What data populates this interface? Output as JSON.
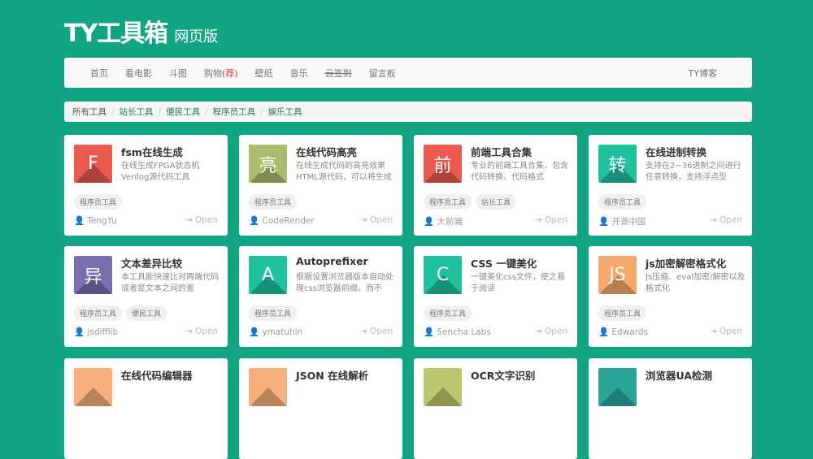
{
  "header": {
    "title": "TY工具箱",
    "subtitle": "网页版"
  },
  "nav": {
    "items": [
      "首页",
      "看电影",
      "斗图"
    ],
    "shop": "购物",
    "shop_hot": "(荐)",
    "items2": [
      "壁纸",
      "音乐",
      "云签到",
      "留言板"
    ],
    "right": "TY博客"
  },
  "breadcrumb": [
    "所有工具",
    "站长工具",
    "便民工具",
    "程序员工具",
    "娱乐工具"
  ],
  "open_label": "Open",
  "cards": [
    {
      "letter": "F",
      "color": "#ea5a4f",
      "title": "fsm在线生成",
      "desc": "在线生成FPGA状态机Verilog源代码工具",
      "tags": [
        "程序员工具"
      ],
      "author": "TengYu"
    },
    {
      "letter": "亮",
      "color": "#a9bd6b",
      "title": "在线代码高亮",
      "desc": "在线生成代码的高亮效果HTML源代码，可以将生成",
      "tags": [
        "程序员工具"
      ],
      "author": "CodeRender"
    },
    {
      "letter": "前",
      "color": "#ea5a4f",
      "title": "前端工具合集",
      "desc": "专业的前端工具合集，包含代码转换、代码格式",
      "tags": [
        "程序员工具",
        "站长工具"
      ],
      "author": "大前端"
    },
    {
      "letter": "转",
      "color": "#1fc19e",
      "title": "在线进制转换",
      "desc": "支持在2~36进制之间进行任意转换，支持浮点型",
      "tags": [
        "程序员工具"
      ],
      "author": "开源中国"
    },
    {
      "letter": "异",
      "color": "#776fb0",
      "title": "文本差异比较",
      "desc": "本工具能快速比对两端代码或者是文本之间的差",
      "tags": [
        "程序员工具",
        "便民工具"
      ],
      "author": "jsdifflib"
    },
    {
      "letter": "A",
      "color": "#1fc19e",
      "title": "Autoprefixer",
      "desc": "根据设置浏览器版本自动处理css浏览器前缀。而不",
      "tags": [
        "程序员工具"
      ],
      "author": "ymatuhin"
    },
    {
      "letter": "C",
      "color": "#1fc19e",
      "title": "CSS 一键美化",
      "desc": "一键美化css文件，使之易于阅读",
      "tags": [
        "程序员工具"
      ],
      "author": "Sencha Labs"
    },
    {
      "letter": "JS",
      "color": "#f5a86a",
      "title": "js加密解密格式化",
      "desc": "Js压缩、eval加密/解密以及格式化",
      "tags": [
        "程序员工具"
      ],
      "author": "Edwards"
    },
    {
      "letter": "",
      "color": "#f7b07c",
      "title": "在线代码编辑器",
      "desc": "",
      "tags": [],
      "author": ""
    },
    {
      "letter": "",
      "color": "#f7b07c",
      "title": "JSON 在线解析",
      "desc": "",
      "tags": [],
      "author": ""
    },
    {
      "letter": "",
      "color": "#bcc76e",
      "title": "OCR文字识别",
      "desc": "",
      "tags": [],
      "author": ""
    },
    {
      "letter": "",
      "color": "#2aa49a",
      "title": "浏览器UA检测",
      "desc": "",
      "tags": [],
      "author": ""
    }
  ]
}
